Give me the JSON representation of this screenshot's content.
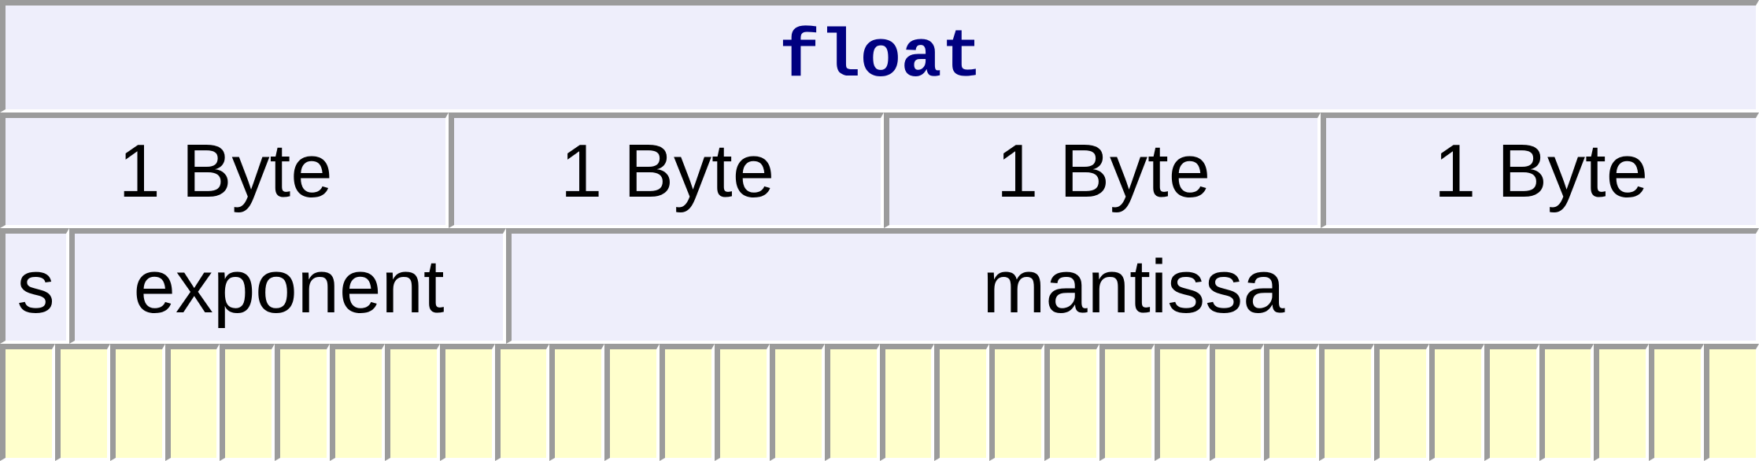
{
  "diagram": {
    "title": "float",
    "byte_row": [
      "1 Byte",
      "1 Byte",
      "1 Byte",
      "1 Byte"
    ],
    "fields": [
      {
        "label": "s",
        "bits": 1
      },
      {
        "label": "exponent",
        "bits": 8
      },
      {
        "label": "mantissa",
        "bits": 23
      }
    ],
    "total_bits": 32,
    "colors": {
      "cell_background": "#eeeefb",
      "bit_background": "#ffffcc",
      "title_text": "#000080",
      "border_shadow": "#9b9b9b"
    }
  }
}
